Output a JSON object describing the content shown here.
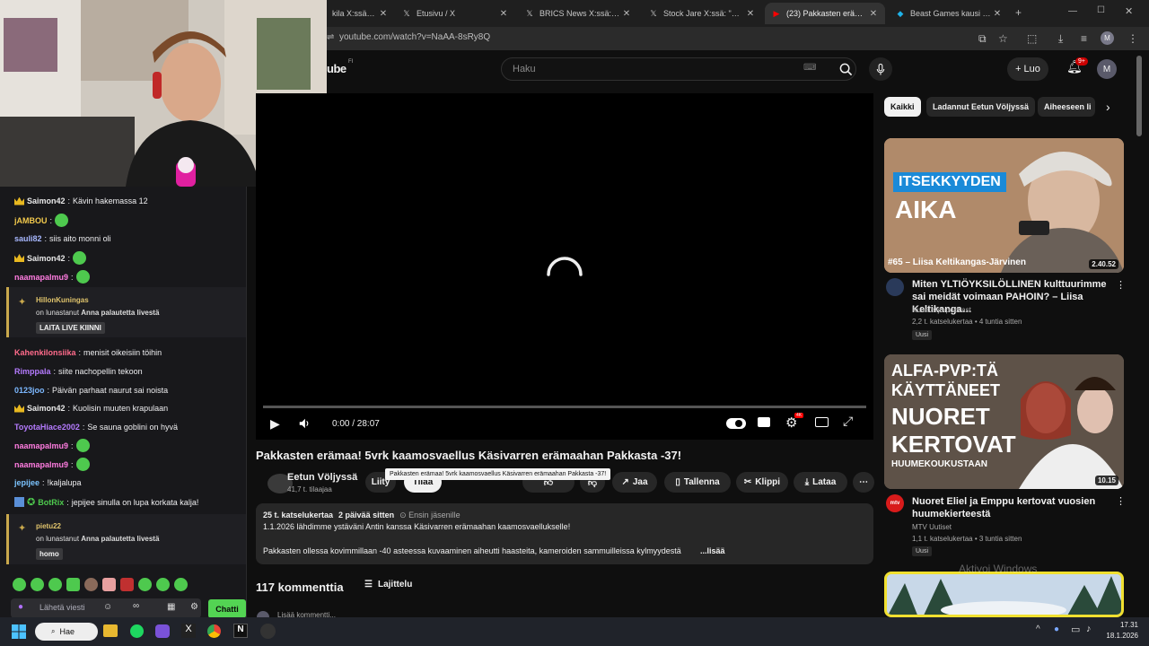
{
  "browser": {
    "tabs": [
      {
        "label": "kila X:ssä: \"Tar",
        "icon": "x-icon"
      },
      {
        "label": "Etusivu / X",
        "icon": "x-icon"
      },
      {
        "label": "BRICS News X:ssä: \"JUST",
        "icon": "x-icon"
      },
      {
        "label": "Stock Jare X:ssä: \"Aiotko",
        "icon": "x-icon"
      },
      {
        "label": "(23) Pakkasten erämaa! 5",
        "icon": "youtube-icon"
      },
      {
        "label": "Beast Games kausi 3 - Ed",
        "icon": "prime-icon"
      }
    ],
    "url": "youtube.com/watch?v=NaAA-8sRy8Q",
    "profile_initial": "M"
  },
  "youtube": {
    "logo_text": "ube",
    "logo_sup": "FI",
    "search_placeholder": "Haku",
    "create_label": "Luo",
    "notif_count": "9+",
    "avatar_initial": "M"
  },
  "chat": {
    "messages": [
      {
        "user": "Saimon42",
        "color": "#e8e8e8",
        "text": "Kävin hakemassa 12",
        "crown": true,
        "emote": false
      },
      {
        "user": "jAMBOU",
        "color": "#f2c94c",
        "text": "",
        "crown": false,
        "emote": true
      },
      {
        "user": "sauli82",
        "color": "#a8b8ff",
        "text": "siis aito monni oli",
        "crown": false,
        "emote": false
      },
      {
        "user": "Saimon42",
        "color": "#e8e8e8",
        "text": "",
        "crown": true,
        "emote": true
      },
      {
        "user": "naamapalmu9",
        "color": "#ff7ce0",
        "text": "",
        "crown": false,
        "emote": true
      }
    ],
    "redeem1": {
      "user": "HillonKuningas",
      "text": "on lunastanut",
      "reward": "Anna palautetta livestä",
      "message": "LAITA LIVE KIINNI"
    },
    "messages2": [
      {
        "user": "Kahenkilonsiika",
        "color": "#ff6b8b",
        "text": "menisit oikeisiin töihin",
        "crown": false,
        "emote": false
      },
      {
        "user": "Rimppala",
        "color": "#b57bff",
        "text": "siite nachopellin tekoon",
        "crown": false,
        "emote": false
      },
      {
        "user": "0123joo",
        "color": "#7cb8ff",
        "text": "Päivän parhaat naurut sai noista",
        "crown": false,
        "emote": false
      },
      {
        "user": "Saimon42",
        "color": "#e8e8e8",
        "text": "Kuolisin muuten krapulaan",
        "crown": true,
        "emote": false
      },
      {
        "user": "ToyotaHiace2002",
        "color": "#b57bff",
        "text": "Se sauna goblini on hyvä",
        "crown": false,
        "emote": false
      },
      {
        "user": "naamapalmu9",
        "color": "#ff7ce0",
        "text": "",
        "crown": false,
        "emote": true
      },
      {
        "user": "naamapalmu9",
        "color": "#ff7ce0",
        "text": "",
        "crown": false,
        "emote": true
      },
      {
        "user": "jepijee",
        "color": "#7cc4ff",
        "text": "!kaljalupa",
        "crown": false,
        "emote": false
      },
      {
        "user": "BotRix",
        "color": "#4ec94e",
        "text": "jepijee sinulla on lupa korkata kalja!",
        "crown": false,
        "emote": false
      }
    ],
    "redeem2": {
      "user": "pietu22",
      "text": "on lunastanut",
      "reward": "Anna palautetta livestä",
      "message": "homo"
    },
    "input_placeholder": "Lähetä viesti",
    "send_label": "Chatti"
  },
  "player": {
    "time": "0:00 / 28:07",
    "progress_fraction": 0.0
  },
  "video": {
    "title": "Pakkasten erämaa! 5vrk kaamosvaellus Käsivarren erämaahan Pakkasta -37!",
    "tooltip": "Pakkasten erämaa! 5vrk kaamosvaellus Käsivarren erämaahan Pakkasta -37!",
    "channel": "Eetun Völjyssä",
    "subs": "41,7 t. tilaajaa",
    "join_label": "Liity",
    "subscribe_label": "Tilaa",
    "share_label": "Jaa",
    "save_label": "Tallenna",
    "clip_label": "Klippi",
    "download_label": "Lataa",
    "views": "25 t. katselukertaa",
    "age": "2 päivää sitten",
    "members_first": "Ensin jäsenille",
    "desc1": "1.1.2026 lähdimme ystäväni Antin kanssa Käsivarren erämaahan kaamosvaellukselle!",
    "desc2": "Pakkasten ollessa kovimmillaan -40 asteessa kuvaaminen aiheutti haasteita, kameroiden sammuilleissa kylmyydestä",
    "more": "...lisää",
    "comments": "117 kommenttia",
    "sort": "Lajittelu",
    "add_comment": "Lisää kommentti..."
  },
  "sidebar": {
    "chips": [
      "Kaikki",
      "Ladannut Eetun Völjyssä",
      "Aiheeseen li"
    ],
    "videos": [
      {
        "thumb_line1": "ITSEKKYYDEN",
        "thumb_line2": "AIKA",
        "thumb_caption": "#65 – Liisa Keltikangas-Järvinen",
        "duration": "2.40.52",
        "title": "Miten YLTIÖYKSILÖLLINEN kulttuurimme sai meidät voimaan PAHOIN? – Liisa Keltikanga…",
        "channel": "Kuuntelija-podcast",
        "meta": "2,2 t. katselukertaa • 4 tuntia sitten",
        "badge": "Uusi"
      },
      {
        "thumb_line1": "ALFA-PVP:TÄ",
        "thumb_line2": "KÄYTTÄNEET",
        "thumb_line3": "NUORET",
        "thumb_line4": "KERTOVAT",
        "thumb_line5": "HUUMEKOUKUSTAAN",
        "duration": "10.15",
        "title": "Nuoret Eliel ja Emppu kertovat vuosien huumekierteestä",
        "channel": "MTV Uutiset",
        "meta": "1,1 t. katselukertaa • 3 tuntia sitten",
        "badge": "Uusi",
        "avatar_text": "mtv"
      }
    ],
    "watermark": "Aktivoi Windows"
  },
  "taskbar": {
    "search_label": "Hae",
    "time": "17.31",
    "date": "18.1.2026"
  }
}
